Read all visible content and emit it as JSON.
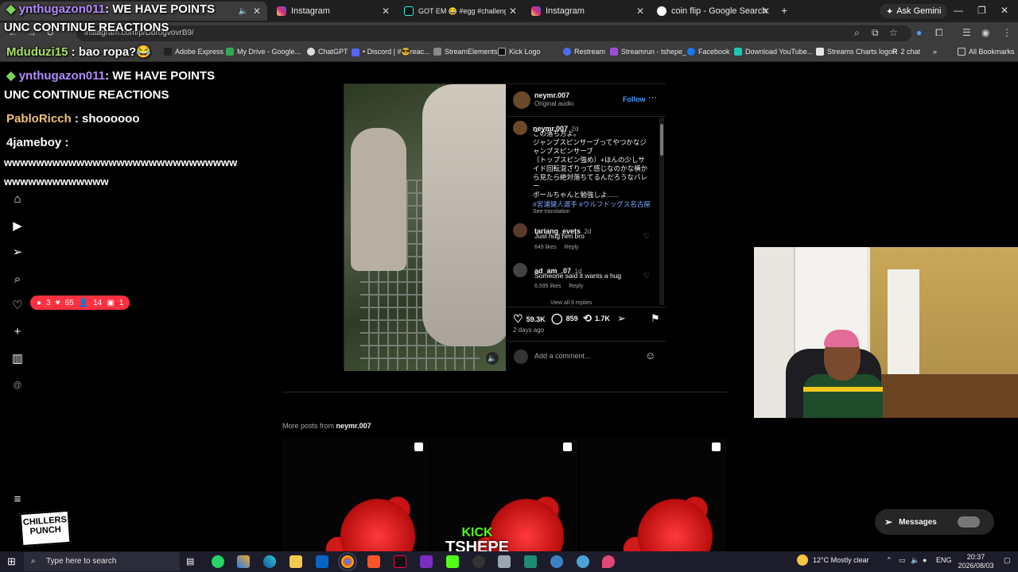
{
  "browser": {
    "tabs": [
      {
        "label": "",
        "active": true
      },
      {
        "label": "Instagram"
      },
      {
        "label": "GOT EM 😂 #egg #challenge #"
      },
      {
        "label": "Instagram"
      },
      {
        "label": "coin flip - Google Search"
      }
    ],
    "ask_gemini": "Ask Gemini",
    "url": "instagram.com/p/DbrogvovrB9/",
    "bookmarks": [
      "Adobe Express",
      "My Drive - Google...",
      "ChatGPT",
      "• Discord | #😎reac...",
      "StreamElements",
      "Kick Logo",
      "Restream",
      "Streamrun - tshepe_",
      "Facebook",
      "Download YouTube...",
      "Streams Charts logo",
      "2 chat",
      "All Bookmarks"
    ]
  },
  "notifications": {
    "comments": "3",
    "likes": "65",
    "follows": "14",
    "other": "1"
  },
  "post": {
    "author": "neymr.007",
    "audio": "Original audio",
    "follow": "Follow",
    "caption": {
      "user": "neymr.007",
      "time": "2d",
      "lines": [
        "この落ち方よ。",
        "ジャンプスピンサーブってやつかなジ",
        "ャンプスピンサーブ",
        "（トップスピン強め）+ほんの少しサ",
        "イド回転混ざりって感じなのかな横か",
        "ら見たら絶対落ちてるんだろうなバレ",
        "ー",
        "ボールちゃんと勉強しよ......"
      ],
      "hashtags": "#宮浦健人選手 #ウルフドッグス名古屋",
      "see_translation": "See translation"
    },
    "comments": [
      {
        "user": "tariang_evets",
        "time": "2d",
        "text": "Just hug him bro",
        "likes": "649 likes",
        "reply": "Reply"
      },
      {
        "user": "ad_am_.07",
        "time": "1d",
        "text": "Someone said it wants a hug",
        "likes": "6,595 likes",
        "reply": "Reply",
        "view_replies": "View all 9 replies"
      }
    ],
    "stats": {
      "likes": "59.3K",
      "comments": "859",
      "reposts": "1.7K"
    },
    "date": "2 days ago",
    "add_comment_placeholder": "Add a comment..."
  },
  "more_posts": {
    "prefix": "More posts from",
    "user": "neymr.007"
  },
  "chat": [
    {
      "user": "ynthugazon011",
      "text": ": WE HAVE POINTS"
    },
    {
      "line": "UNC CONTINUE REACTIONS"
    },
    {
      "user": "Mduduzi15",
      "text": ": bao ropa?😂"
    },
    {
      "user": "ynthugazon011",
      "text": ": WE HAVE POINTS"
    },
    {
      "line": "UNC CONTINUE REACTIONS"
    },
    {
      "user": "PabloRicch",
      "text": ": shoooooo"
    },
    {
      "user": "4jameboy",
      "text": ":"
    },
    {
      "line": "wwwwwwwwwwwwwwwwwwwwwwwwwwwww"
    },
    {
      "line": "wwwwwwwwwwwww"
    }
  ],
  "messages": "Messages",
  "overlay": {
    "chillers_line1": "CHILLERS",
    "chillers_line2": "PUNCH",
    "kick": "KICK",
    "tshepe": "TSHEPE"
  },
  "taskbar": {
    "search_placeholder": "Type here to search",
    "weather": "12°C  Mostly clear",
    "lang": "ENG",
    "time": "20:37",
    "date": "2026/08/03"
  }
}
